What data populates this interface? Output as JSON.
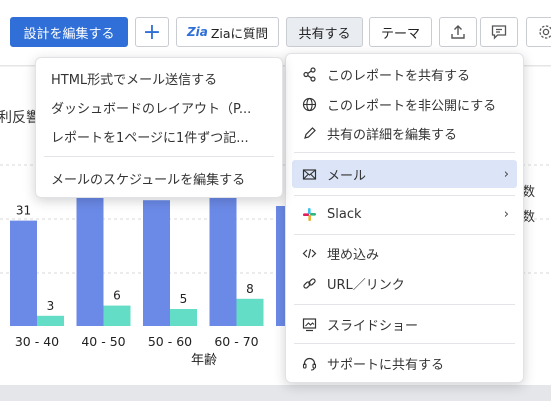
{
  "toolbar": {
    "edit_design": "設計を編集する",
    "add": "+",
    "zia_logo": "Zia",
    "zia_label": "Ziaに質問",
    "share": "共有する",
    "theme": "テーマ"
  },
  "report": {
    "title_fragment": "利反響",
    "right_labels": [
      "数",
      "数"
    ]
  },
  "chart_data": {
    "type": "bar",
    "xlabel": "年齢",
    "categories": [
      "30 - 40",
      "40 - 50",
      "50 - 60",
      "60 - 70"
    ],
    "series": [
      {
        "color": "#6b8ae8",
        "values": [
          31,
          41,
          37,
          42
        ]
      },
      {
        "color": "#63ddc6",
        "values": [
          3,
          6,
          5,
          8
        ]
      }
    ]
  },
  "share_menu": {
    "items": [
      {
        "label": "このレポートを共有する",
        "icon": "share-icon"
      },
      {
        "label": "このレポートを非公開にする",
        "icon": "globe-icon"
      },
      {
        "label": "共有の詳細を編集する",
        "icon": "pencil-icon"
      },
      {
        "label": "メール",
        "icon": "mail-icon"
      },
      {
        "label": "Slack",
        "icon": "slack-icon"
      },
      {
        "label": "埋め込み",
        "icon": "code-icon"
      },
      {
        "label": "URL／リンク",
        "icon": "link-icon"
      },
      {
        "label": "スライドショー",
        "icon": "slideshow-icon"
      },
      {
        "label": "サポートに共有する",
        "icon": "headset-icon"
      }
    ],
    "submenu_arrow": "›"
  },
  "mail_menu": {
    "items": [
      "HTML形式でメール送信する",
      "ダッシュボードのレイアウト（P...",
      "レポートを1ページに1件ずつ記...",
      "メールのスケジュールを編集する"
    ]
  }
}
